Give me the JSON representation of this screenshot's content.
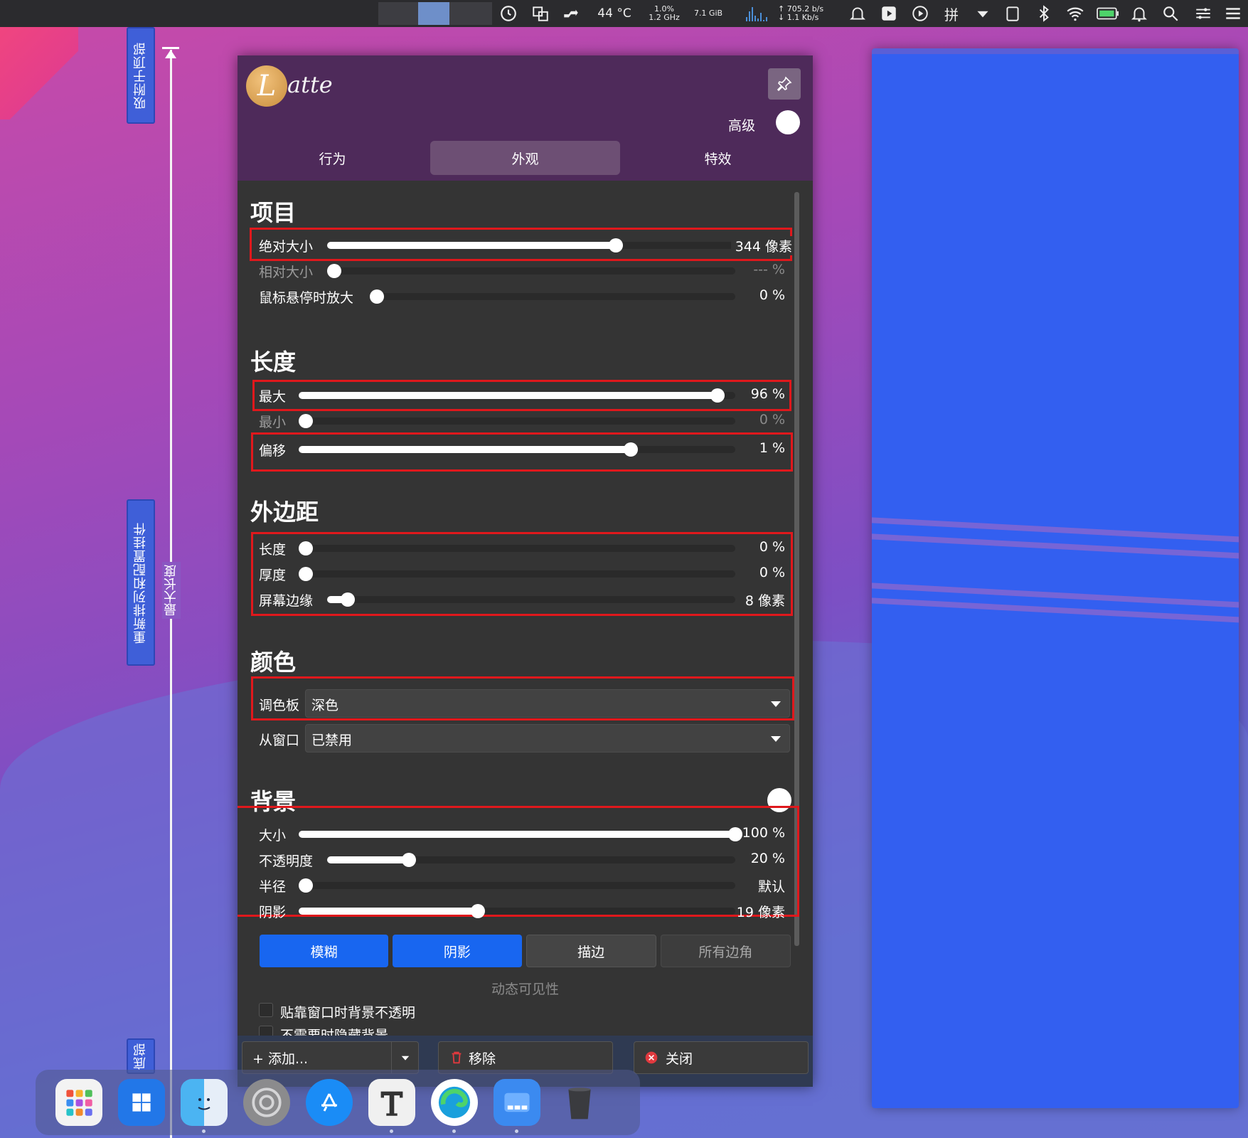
{
  "menubar": {
    "temperature": "44 °C",
    "cpu_line1": "1.0%",
    "cpu_line2": "1.2 GHz",
    "memory": "7.1 GiB",
    "net_up": "↑ 705.2 b/s",
    "net_down": "↓ 1.1 Kb/s",
    "input_method": "拼"
  },
  "edit_strip": {
    "snap_top_label": "吸附于顶部",
    "rearrange_label": "重新排列和配置挂件",
    "bottom_label": "底部",
    "ruler_label": "最大长度"
  },
  "window": {
    "logo_letter": "L",
    "logo_text": "atte",
    "advanced_label": "高级",
    "tabs": [
      {
        "label": "行为",
        "active": false
      },
      {
        "label": "外观",
        "active": true
      },
      {
        "label": "特效",
        "active": false
      }
    ]
  },
  "items_section": {
    "title": "项目",
    "absolute_size": {
      "label": "绝对大小",
      "value": "344 像素",
      "fraction": 0.63
    },
    "relative_size": {
      "label": "相对大小",
      "value": "--- %",
      "fraction": 0.0
    },
    "zoom_on_hover": {
      "label": "鼠标悬停时放大",
      "value": "0 %",
      "fraction": 0.0
    }
  },
  "length_section": {
    "title": "长度",
    "max": {
      "label": "最大",
      "value": "96 %",
      "fraction": 0.96
    },
    "min": {
      "label": "最小",
      "value": "0 %",
      "fraction": 0.0
    },
    "offset": {
      "label": "偏移",
      "value": "1 %",
      "fraction": 0.76
    }
  },
  "margins_section": {
    "title": "外边距",
    "length": {
      "label": "长度",
      "value": "0 %",
      "fraction": 0.0
    },
    "thickness": {
      "label": "厚度",
      "value": "0 %",
      "fraction": 0.0
    },
    "screen_edge": {
      "label": "屏幕边缘",
      "value": "8 像素",
      "fraction": 0.05
    }
  },
  "colors_section": {
    "title": "颜色",
    "palette": {
      "label": "调色板",
      "value": "深色"
    },
    "from_window": {
      "label": "从窗口",
      "value": "已禁用"
    }
  },
  "background_section": {
    "title": "背景",
    "size": {
      "label": "大小",
      "value": "100 %",
      "fraction": 1.0
    },
    "opacity": {
      "label": "不透明度",
      "value": "20 %",
      "fraction": 0.2
    },
    "radius": {
      "label": "半径",
      "value": "默认",
      "fraction": 0.0
    },
    "shadow": {
      "label": "阴影",
      "value": "19 像素",
      "fraction": 0.41
    },
    "buttons": [
      {
        "label": "模糊",
        "state": "on"
      },
      {
        "label": "阴影",
        "state": "on"
      },
      {
        "label": "描边",
        "state": "off"
      },
      {
        "label": "所有边角",
        "state": "disabled"
      }
    ]
  },
  "dynamic_visibility": {
    "title": "动态可见性",
    "opt1": "贴靠窗口时背景不透明",
    "opt2": "不需要时隐藏背景"
  },
  "footer": {
    "add_label": "+  添加...",
    "remove_label": "移除",
    "close_label": "关闭"
  },
  "colors": {
    "accent_button": "#1866f0",
    "header_purple": "#4e2a5a",
    "highlight_box": "#e0181c",
    "preview_blue": "#335ff0"
  }
}
